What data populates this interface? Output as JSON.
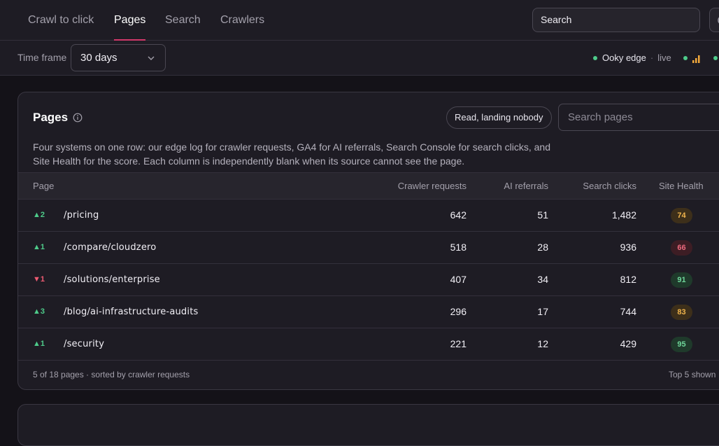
{
  "nav": {
    "tabs": [
      {
        "label": "Crawl to click"
      },
      {
        "label": "Pages"
      },
      {
        "label": "Search"
      },
      {
        "label": "Crawlers"
      }
    ],
    "search_placeholder": "Search"
  },
  "toolbar": {
    "timeframe_label": "Time frame",
    "timeframe_value": "30 days",
    "status_name": "Ooky edge",
    "status_sep": "·",
    "status_state": "live",
    "colors": {
      "live": "#4ecb8a",
      "bars": "#f2a93b"
    }
  },
  "card": {
    "title": "Pages",
    "filter_button": "Read, landing nobody",
    "search_placeholder": "Search pages",
    "description": "Four systems on one row: our edge log for crawler requests, GA4 for AI referrals, Search Console for search clicks, and Site Health for the score. Each column is independently blank when its source cannot see the page.",
    "columns": [
      "Page",
      "Crawler requests",
      "AI referrals",
      "Search clicks",
      "Site Health"
    ],
    "rows": [
      {
        "rank": "▲2",
        "trend": "up",
        "page": "/pricing",
        "crawler": "642",
        "ai": "51",
        "clicks": "1,482",
        "health": "74",
        "health_level": "warn"
      },
      {
        "rank": "▲1",
        "trend": "up",
        "page": "/compare/cloudzero",
        "crawler": "518",
        "ai": "28",
        "clicks": "936",
        "health": "66",
        "health_level": "bad"
      },
      {
        "rank": "▼1",
        "trend": "down",
        "page": "/solutions/enterprise",
        "crawler": "407",
        "ai": "34",
        "clicks": "812",
        "health": "91",
        "health_level": "good"
      },
      {
        "rank": "▲3",
        "trend": "up",
        "page": "/blog/ai-infrastructure-audits",
        "crawler": "296",
        "ai": "17",
        "clicks": "744",
        "health": "83",
        "health_level": "warn"
      },
      {
        "rank": "▲1",
        "trend": "up",
        "page": "/security",
        "crawler": "221",
        "ai": "12",
        "clicks": "429",
        "health": "95",
        "health_level": "good"
      }
    ],
    "footer_left": "5 of 18 pages · sorted by crawler requests",
    "footer_right": "Top 5 shown",
    "badge_colors": {
      "good": {
        "bg": "#1f3a2b",
        "fg": "#6fd69a"
      },
      "warn": {
        "bg": "#3d2f1a",
        "fg": "#f0b44c"
      },
      "bad": {
        "bg": "#3d1d24",
        "fg": "#ef6a7e"
      }
    }
  }
}
